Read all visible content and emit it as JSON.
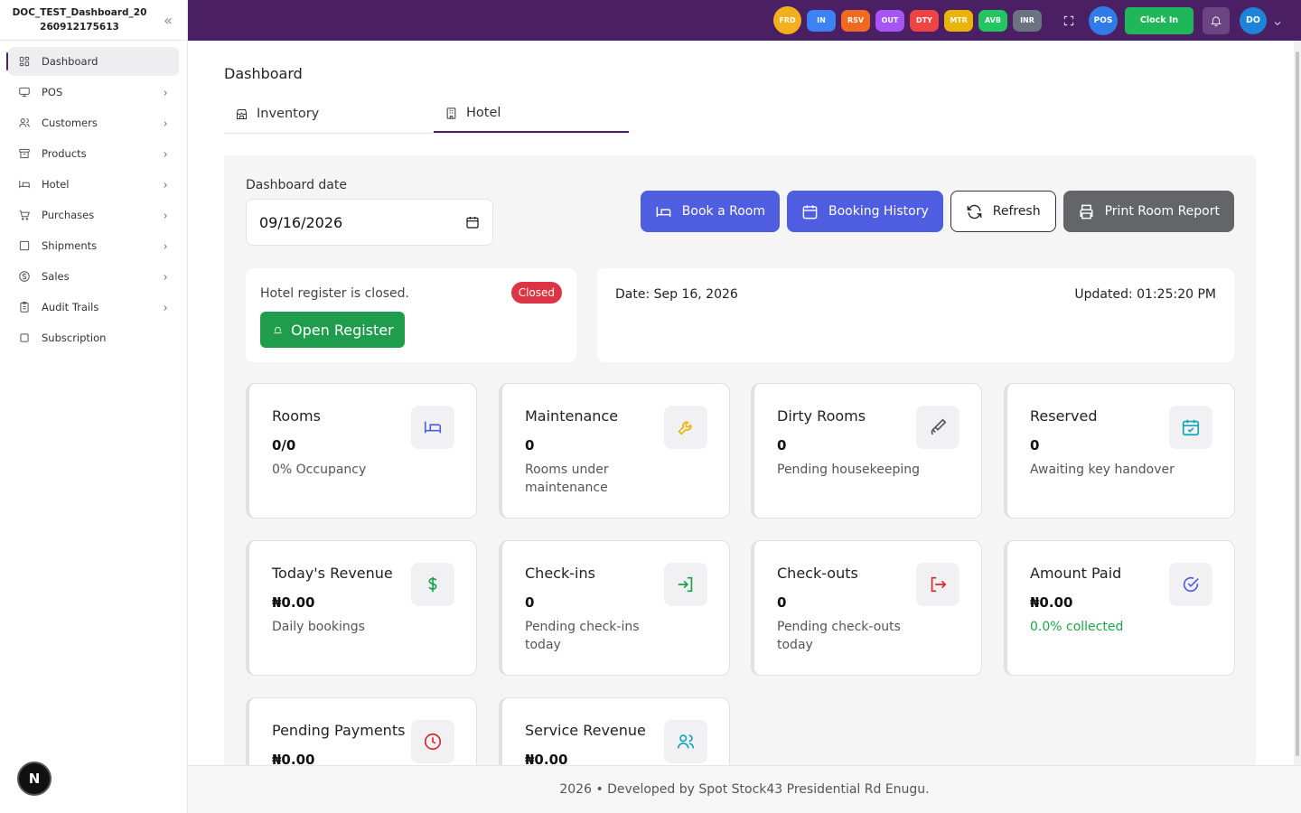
{
  "sidebar": {
    "brand": "DOC_TEST_Dashboard_20260912175613",
    "items": [
      {
        "label": "Dashboard",
        "icon": "dashboard-icon",
        "active": true,
        "chevron": false
      },
      {
        "label": "POS",
        "icon": "monitor-icon",
        "chevron": true
      },
      {
        "label": "Customers",
        "icon": "users-icon",
        "chevron": true
      },
      {
        "label": "Products",
        "icon": "archive-icon",
        "chevron": true
      },
      {
        "label": "Hotel",
        "icon": "bed-icon",
        "chevron": true
      },
      {
        "label": "Purchases",
        "icon": "cart-icon",
        "chevron": true
      },
      {
        "label": "Shipments",
        "icon": "box-icon",
        "chevron": true
      },
      {
        "label": "Sales",
        "icon": "dollar-icon",
        "chevron": true
      },
      {
        "label": "Audit Trails",
        "icon": "clipboard-icon",
        "chevron": true
      },
      {
        "label": "Subscription",
        "icon": "square-icon",
        "chevron": false
      }
    ],
    "n_badge": "N"
  },
  "topbar": {
    "chips": [
      {
        "label": "FRD",
        "color": "#f2b01e",
        "round": true
      },
      {
        "label": "IN",
        "color": "#3b82f6"
      },
      {
        "label": "RSV",
        "color": "#f26a22"
      },
      {
        "label": "OUT",
        "color": "#a855f7"
      },
      {
        "label": "DTY",
        "color": "#ef4444"
      },
      {
        "label": "MTR",
        "color": "#eab308"
      },
      {
        "label": "AVB",
        "color": "#22c55e"
      },
      {
        "label": "INR",
        "color": "#6b7280"
      }
    ],
    "pos_label": "POS",
    "clock_in": "Clock In",
    "user_initials": "DO"
  },
  "main": {
    "title": "Dashboard",
    "tabs": [
      {
        "label": "Inventory",
        "active": false
      },
      {
        "label": "Hotel",
        "active": true
      }
    ],
    "date_label": "Dashboard date",
    "date_value": "09/16/2026",
    "actions": {
      "book": "Book a Room",
      "history": "Booking History",
      "refresh": "Refresh",
      "print": "Print Room Report"
    },
    "register": {
      "text": "Hotel register is closed.",
      "badge": "Closed",
      "button": "Open Register"
    },
    "info": {
      "date": "Date: Sep 16, 2026",
      "updated": "Updated: 01:25:20 PM"
    },
    "cards": [
      {
        "title": "Rooms",
        "value": "0/0",
        "sub": "0% Occupancy",
        "icon": "bed-icon",
        "icon_color": "#4f5ee0"
      },
      {
        "title": "Maintenance",
        "value": "0",
        "sub": "Rooms under maintenance",
        "icon": "wrench-icon",
        "icon_color": "#eab308"
      },
      {
        "title": "Dirty Rooms",
        "value": "0",
        "sub": "Pending housekeeping",
        "icon": "brush-icon",
        "icon_color": "#555"
      },
      {
        "title": "Reserved",
        "value": "0",
        "sub": "Awaiting key handover",
        "icon": "calendar-check-icon",
        "icon_color": "#0ea5b8"
      },
      {
        "title": "Today's Revenue",
        "value": "₦0.00",
        "sub": "Daily bookings",
        "icon": "dollar-icon",
        "icon_color": "#16a34a"
      },
      {
        "title": "Check-ins",
        "value": "0",
        "sub": "Pending check-ins today",
        "icon": "login-icon",
        "icon_color": "#16a34a"
      },
      {
        "title": "Check-outs",
        "value": "0",
        "sub": "Pending check-outs today",
        "icon": "logout-icon",
        "icon_color": "#dc2626"
      },
      {
        "title": "Amount Paid",
        "value": "₦0.00",
        "sub": "0.0% collected",
        "icon": "check-circle-icon",
        "icon_color": "#4f5ee0",
        "sub_green": true
      },
      {
        "title": "Pending Payments",
        "value": "₦0.00",
        "sub": "",
        "icon": "clock-icon",
        "icon_color": "#dc2626"
      },
      {
        "title": "Service Revenue",
        "value": "₦0.00",
        "sub": "",
        "icon": "users-icon",
        "icon_color": "#0ea5b8"
      }
    ]
  },
  "footer": "2026  •  Developed by Spot Stock43 Presidential Rd Enugu."
}
